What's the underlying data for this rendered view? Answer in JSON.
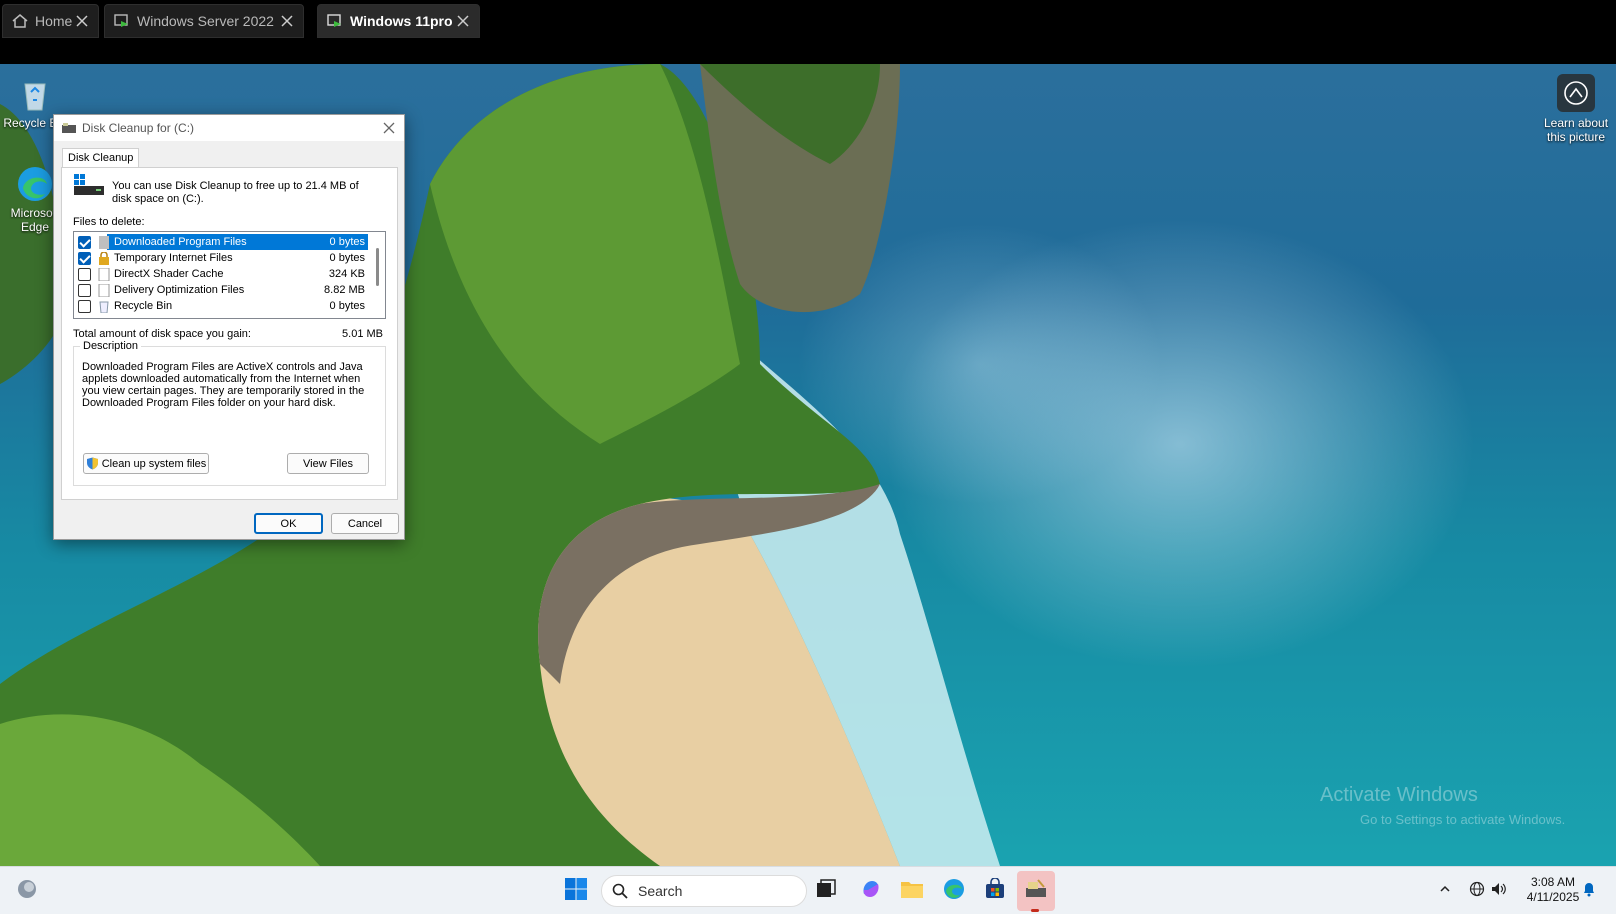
{
  "vm_tabs": [
    {
      "label": "Home",
      "icon": "home-icon"
    },
    {
      "label": "Windows Server 2022",
      "icon": "vm-icon"
    },
    {
      "label": "Windows 11pro",
      "icon": "vm-icon",
      "active": true
    }
  ],
  "desktop": {
    "icons": [
      {
        "label": "Recycle Bin",
        "icon": "recycle-bin-icon"
      },
      {
        "label": "Microsoft Edge",
        "icon": "edge-icon"
      }
    ],
    "learn_about": "Learn about this picture",
    "watermark_title": "Activate Windows",
    "watermark_sub": "Go to Settings to activate Windows."
  },
  "dialog": {
    "title": "Disk Cleanup for  (C:)",
    "tab": "Disk Cleanup",
    "intro": "You can use Disk Cleanup to free up to 21.4 MB of disk space on  (C:).",
    "files_label": "Files to delete:",
    "files": [
      {
        "name": "Downloaded Program Files",
        "size": "0 bytes",
        "checked": true,
        "selected": true
      },
      {
        "name": "Temporary Internet Files",
        "size": "0 bytes",
        "checked": true,
        "selected": false
      },
      {
        "name": "DirectX Shader Cache",
        "size": "324 KB",
        "checked": false,
        "selected": false
      },
      {
        "name": "Delivery Optimization Files",
        "size": "8.82 MB",
        "checked": false,
        "selected": false
      },
      {
        "name": "Recycle Bin",
        "size": "0 bytes",
        "checked": false,
        "selected": false
      }
    ],
    "total_label": "Total amount of disk space you gain:",
    "total_value": "5.01 MB",
    "description_legend": "Description",
    "description": "Downloaded Program Files are ActiveX controls and Java applets downloaded automatically from the Internet when you view certain pages. They are temporarily stored in the Downloaded Program Files folder on your hard disk.",
    "cleanup_button": "Clean up system files",
    "view_files_button": "View Files",
    "ok_button": "OK",
    "cancel_button": "Cancel"
  },
  "taskbar": {
    "search_placeholder": "Search",
    "time": "3:08 AM",
    "date": "4/11/2025"
  },
  "colors": {
    "selection": "#0078d7",
    "accent": "#0067c0",
    "taskbar": "#eef2f6"
  }
}
